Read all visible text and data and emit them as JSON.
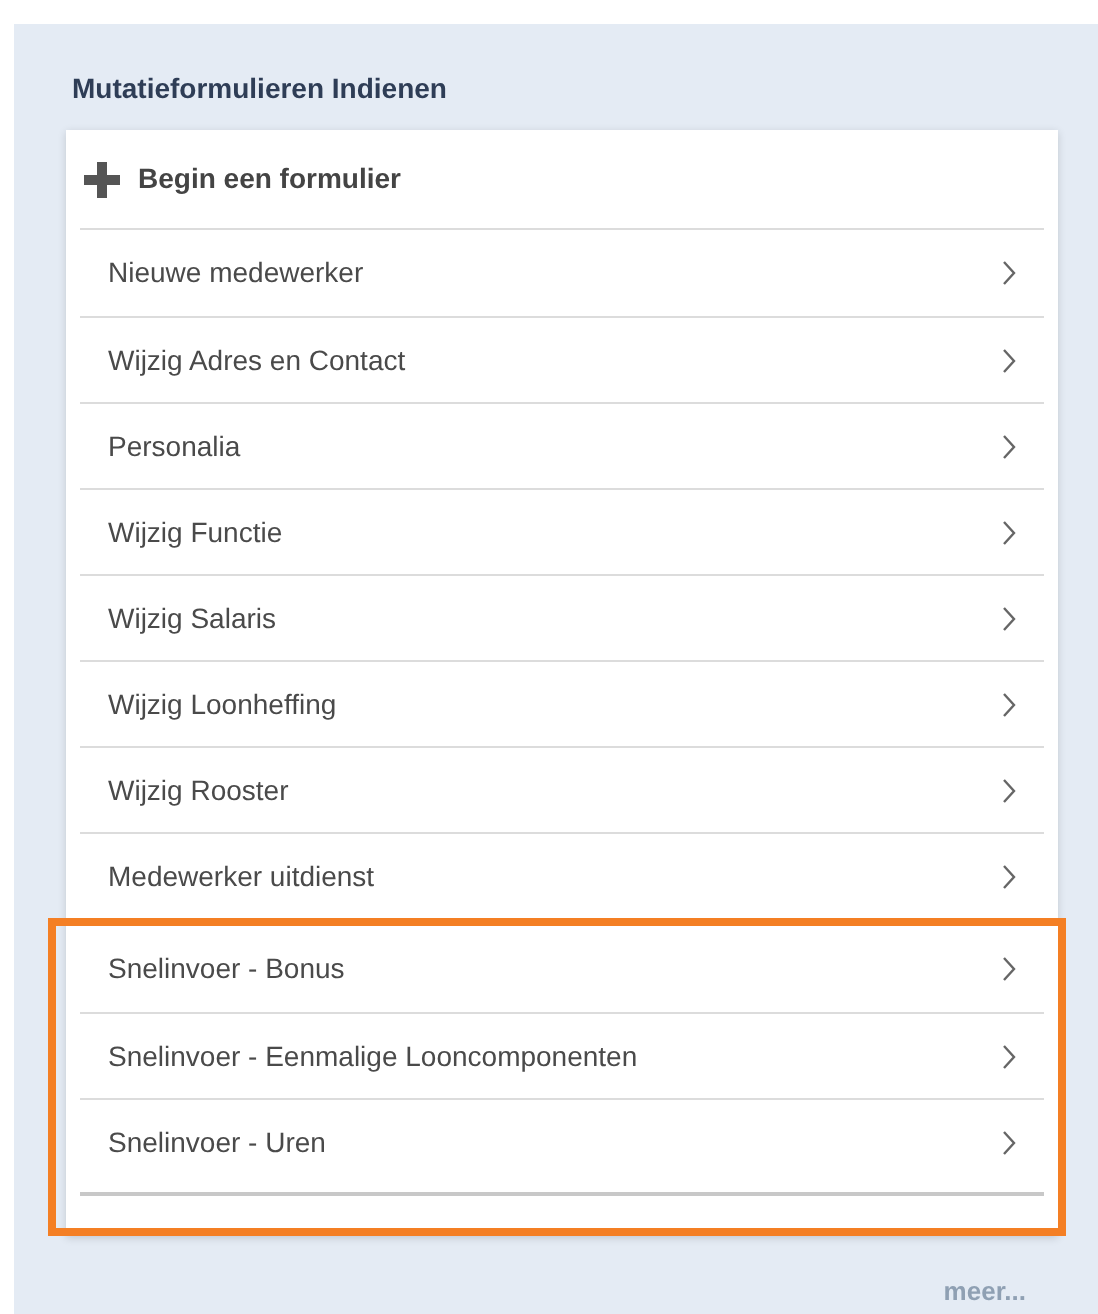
{
  "panel": {
    "title": "Mutatieformulieren Indienen"
  },
  "header": {
    "label": "Begin een formulier"
  },
  "items": [
    {
      "label": "Nieuwe medewerker",
      "highlighted": false
    },
    {
      "label": "Wijzig Adres en Contact",
      "highlighted": false
    },
    {
      "label": "Personalia",
      "highlighted": false
    },
    {
      "label": "Wijzig Functie",
      "highlighted": false
    },
    {
      "label": "Wijzig Salaris",
      "highlighted": false
    },
    {
      "label": "Wijzig Loonheffing",
      "highlighted": false
    },
    {
      "label": "Wijzig Rooster",
      "highlighted": false
    },
    {
      "label": "Medewerker uitdienst",
      "highlighted": false
    },
    {
      "label": "Snelinvoer - Bonus",
      "highlighted": true
    },
    {
      "label": "Snelinvoer - Eenmalige Looncomponenten",
      "highlighted": true
    },
    {
      "label": "Snelinvoer - Uren",
      "highlighted": true
    }
  ],
  "more_link": "meer..."
}
